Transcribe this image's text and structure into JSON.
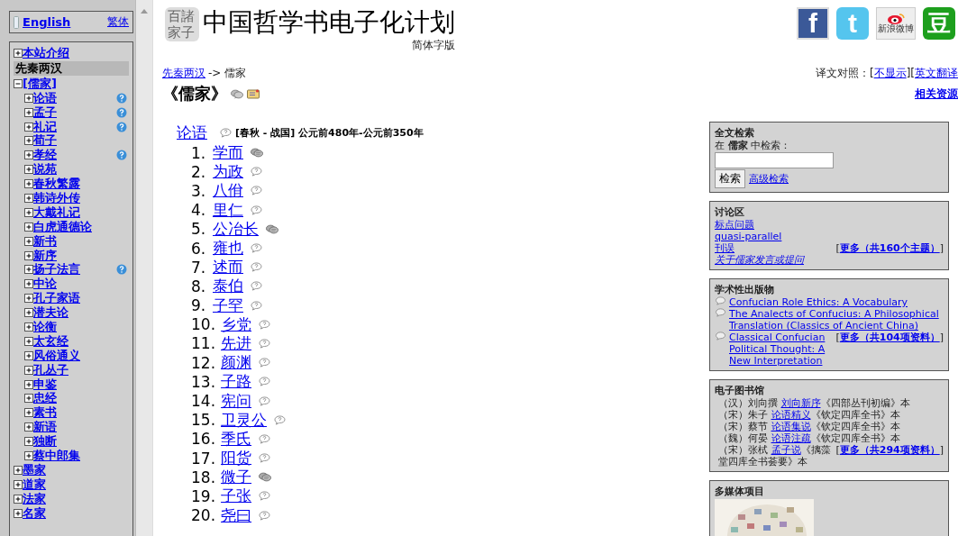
{
  "sidebar": {
    "language": {
      "english": "English",
      "traditional": "繁体"
    },
    "tree": [
      {
        "kind": "node",
        "label": "本站介绍",
        "expanded": false
      },
      {
        "kind": "heading",
        "label": "先秦两汉"
      },
      {
        "kind": "node",
        "label": "[儒家]",
        "expanded": true,
        "children": [
          {
            "label": "论语",
            "expanded": false,
            "help": true
          },
          {
            "label": "孟子",
            "expanded": false,
            "help": true
          },
          {
            "label": "礼记",
            "expanded": false,
            "help": true
          },
          {
            "label": "荀子",
            "expanded": false,
            "help": false
          },
          {
            "label": "孝经",
            "expanded": false,
            "help": true
          },
          {
            "label": "说苑",
            "expanded": false,
            "help": false
          },
          {
            "label": "春秋繁露",
            "expanded": false,
            "help": false
          },
          {
            "label": "韩诗外传",
            "expanded": false,
            "help": false
          },
          {
            "label": "大戴礼记",
            "expanded": false,
            "help": false
          },
          {
            "label": "白虎通德论",
            "expanded": false,
            "help": false
          },
          {
            "label": "新书",
            "expanded": false,
            "help": false
          },
          {
            "label": "新序",
            "expanded": false,
            "help": false
          },
          {
            "label": "扬子法言",
            "expanded": false,
            "help": true
          },
          {
            "label": "中论",
            "expanded": false,
            "help": false
          },
          {
            "label": "孔子家语",
            "expanded": false,
            "help": false
          },
          {
            "label": "潜夫论",
            "expanded": false,
            "help": false
          },
          {
            "label": "论衡",
            "expanded": false,
            "help": false
          },
          {
            "label": "太玄经",
            "expanded": false,
            "help": false
          },
          {
            "label": "风俗通义",
            "expanded": false,
            "help": false
          },
          {
            "label": "孔丛子",
            "expanded": false,
            "help": false
          },
          {
            "label": "申鉴",
            "expanded": false,
            "help": false
          },
          {
            "label": "忠经",
            "expanded": false,
            "help": false
          },
          {
            "label": "素书",
            "expanded": false,
            "help": false
          },
          {
            "label": "新语",
            "expanded": false,
            "help": false
          },
          {
            "label": "独断",
            "expanded": false,
            "help": false
          },
          {
            "label": "蔡中郎集",
            "expanded": false,
            "help": false
          }
        ]
      },
      {
        "kind": "node",
        "label": "墨家",
        "expanded": false
      },
      {
        "kind": "node",
        "label": "道家",
        "expanded": false
      },
      {
        "kind": "node",
        "label": "法家",
        "expanded": false
      },
      {
        "kind": "node",
        "label": "名家",
        "expanded": false
      }
    ]
  },
  "header": {
    "logo": "百諸家子",
    "title": "中国哲学书电子化计划",
    "subtitle": "简体字版",
    "social": [
      {
        "kind": "facebook",
        "label": "f"
      },
      {
        "kind": "twitter",
        "label": "t"
      },
      {
        "kind": "weibo",
        "label": "新浪微博"
      },
      {
        "kind": "douban",
        "label": "豆"
      }
    ]
  },
  "breadcrumb": {
    "link": "先秦两汉",
    "rest": "-> 儒家"
  },
  "translation": {
    "label": "译文对照：",
    "options": [
      {
        "open": "[",
        "label": "不显示",
        "close": "]"
      },
      {
        "open": "[",
        "label": "英文翻译"
      }
    ]
  },
  "related": "相关资源",
  "heading": "《儒家》",
  "book": {
    "title": "论语",
    "period": "[春秋 - 战国] 公元前480年-公元前350年",
    "chapters": [
      {
        "number": "1.",
        "title": "学而",
        "kind": "discuss"
      },
      {
        "number": "2.",
        "title": "为政",
        "kind": "question"
      },
      {
        "number": "3.",
        "title": "八佾",
        "kind": "question"
      },
      {
        "number": "4.",
        "title": "里仁",
        "kind": "question"
      },
      {
        "number": "5.",
        "title": "公冶长",
        "kind": "discuss"
      },
      {
        "number": "6.",
        "title": "雍也",
        "kind": "question"
      },
      {
        "number": "7.",
        "title": "述而",
        "kind": "question"
      },
      {
        "number": "8.",
        "title": "泰伯",
        "kind": "question"
      },
      {
        "number": "9.",
        "title": "子罕",
        "kind": "question"
      },
      {
        "number": "10.",
        "title": "乡党",
        "kind": "question"
      },
      {
        "number": "11.",
        "title": "先进",
        "kind": "question"
      },
      {
        "number": "12.",
        "title": "颜渊",
        "kind": "question"
      },
      {
        "number": "13.",
        "title": "子路",
        "kind": "question"
      },
      {
        "number": "14.",
        "title": "宪问",
        "kind": "question"
      },
      {
        "number": "15.",
        "title": "卫灵公",
        "kind": "question"
      },
      {
        "number": "16.",
        "title": "季氏",
        "kind": "question"
      },
      {
        "number": "17.",
        "title": "阳货",
        "kind": "question"
      },
      {
        "number": "18.",
        "title": "微子",
        "kind": "discuss"
      },
      {
        "number": "19.",
        "title": "子张",
        "kind": "question"
      },
      {
        "number": "20.",
        "title": "尧曰",
        "kind": "question"
      }
    ]
  },
  "panels": [
    {
      "kind": "search",
      "title": "全文检索",
      "prompt": "在 **儒家** 中检索：",
      "button": "检索",
      "link": "高级检索"
    },
    {
      "kind": "discussion",
      "title": "讨论区",
      "items": [
        {
          "label": "标点问题",
          "italic": false
        },
        {
          "label": "quasi-parallel",
          "italic": false
        },
        {
          "label": "刊误",
          "italic": false
        },
        {
          "label": "关于儒家发言或提问",
          "italic": true
        }
      ],
      "more": {
        "open": "[",
        "label": "更多（共160个主题）",
        "close": "]"
      }
    },
    {
      "kind": "publications",
      "title": "学术性出版物",
      "items": [
        {
          "label": "Confucian Role Ethics: A Vocabulary"
        },
        {
          "label": "The Analects of Confucius: A Philosophical Translation (Classics of Ancient China)"
        },
        {
          "label": "Classical Confucian Political Thought: A New Interpretation"
        }
      ],
      "more": {
        "open": "[",
        "label": "更多（共104项资料）",
        "close": "]"
      }
    },
    {
      "kind": "library",
      "title": "电子图书馆",
      "items": [
        {
          "prefix": "（汉）刘向撰",
          "label": "刘向新序",
          "suffix": "《四部丛刊初编》本"
        },
        {
          "prefix": "（宋）朱子",
          "label": "论语精义",
          "suffix": "《钦定四库全书》本"
        },
        {
          "prefix": "（宋）蔡节",
          "label": "论语集说",
          "suffix": "《钦定四库全书》本"
        },
        {
          "prefix": "（魏）何晏",
          "label": "论语注疏",
          "suffix": "《钦定四库全书》本"
        },
        {
          "prefix": "（宋）张栻",
          "label": "孟子说",
          "suffix": "《摛藻堂四库全书荟要》本"
        }
      ],
      "more": {
        "open": "[",
        "label": "更多（共294项资料）",
        "close": "]"
      }
    },
    {
      "kind": "media",
      "title": "多媒体项目"
    }
  ]
}
